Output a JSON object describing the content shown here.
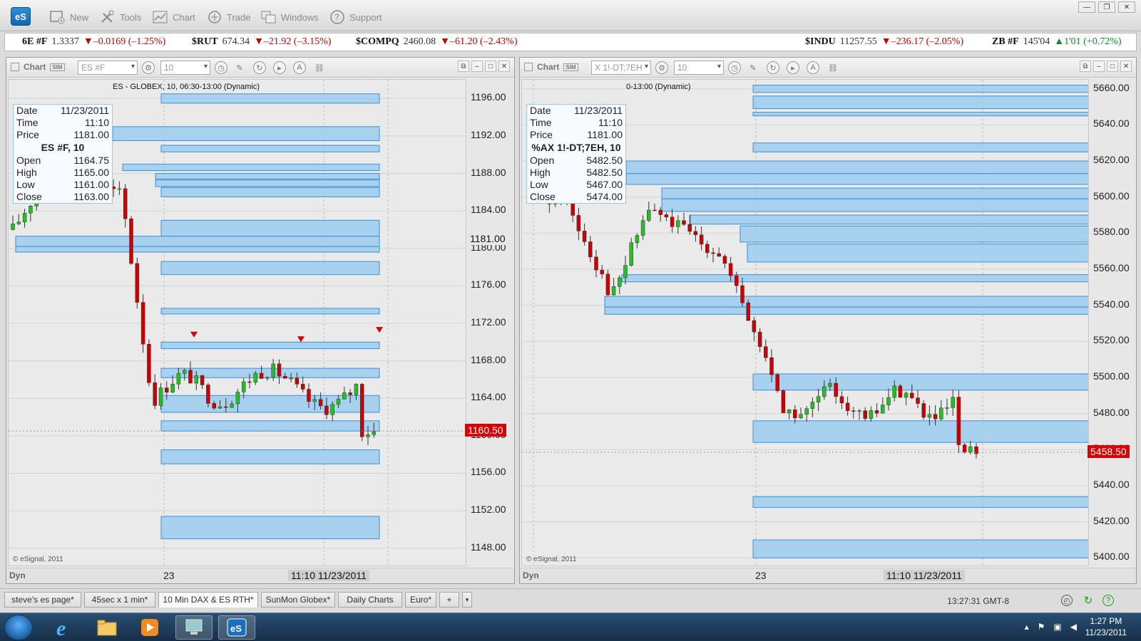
{
  "app": {
    "logo": "eS",
    "toolbar": [
      {
        "label": "New",
        "icon": "new-window-icon"
      },
      {
        "label": "Tools",
        "icon": "tools-icon"
      },
      {
        "label": "Chart",
        "icon": "chart-icon"
      },
      {
        "label": "Trade",
        "icon": "trade-icon"
      },
      {
        "label": "Windows",
        "icon": "windows-icon"
      },
      {
        "label": "Support",
        "icon": "help-icon"
      }
    ]
  },
  "ticker": [
    {
      "symbol": "6E #F",
      "price": "1.3337",
      "change": "▼–0.0169 (–1.25%)",
      "dir": "down"
    },
    {
      "symbol": "$RUT",
      "price": "674.34",
      "change": "▼–21.92 (–3.15%)",
      "dir": "down"
    },
    {
      "symbol": "$COMPQ",
      "price": "2460.08",
      "change": "▼–61.20 (–2.43%)",
      "dir": "down"
    },
    {
      "symbol": "$INDU",
      "price": "11257.55",
      "change": "▼–236.17 (–2.05%)",
      "dir": "down"
    },
    {
      "symbol": "ZB #F",
      "price": "145'04",
      "change": "▲1'01 (+0.72%)",
      "dir": "up"
    }
  ],
  "left_chart": {
    "title": "Chart",
    "symbol": "ES #F",
    "interval": "10",
    "study_label": "ES - GLOBEX, 10, 06:30-13:00 (Dynamic)",
    "info": {
      "rows_top": [
        [
          "Date",
          "11/23/2011"
        ],
        [
          "Time",
          "11:10"
        ],
        [
          "Price",
          "1181.00"
        ]
      ],
      "header": "ES #F, 10",
      "rows_bottom": [
        [
          "Open",
          "1164.75"
        ],
        [
          "High",
          "1165.00"
        ],
        [
          "Low",
          "1161.00"
        ],
        [
          "Close",
          "1163.00"
        ]
      ]
    },
    "y_ticks": [
      "1196.00",
      "1192.00",
      "1188.00",
      "1184.00",
      "1180.00",
      "1176.00",
      "1172.00",
      "1168.00",
      "1164.00",
      "1160.00",
      "1156.00",
      "1152.00",
      "1148.00"
    ],
    "crosshair_price": "1181.00",
    "last_price": "1160.50",
    "x_label": "23",
    "x_time": "11:10 11/23/2011",
    "copyright": "© eSignal, 2011",
    "dyn": "Dyn"
  },
  "right_chart": {
    "title": "Chart",
    "symbol": "X 1!-DT;7EH",
    "interval": "10",
    "study_label": "0-13:00 (Dynamic)",
    "info": {
      "rows_top": [
        [
          "Date",
          "11/23/2011"
        ],
        [
          "Time",
          "11:10"
        ],
        [
          "Price",
          "1181.00"
        ]
      ],
      "header": "%AX 1!-DT;7EH, 10",
      "rows_bottom": [
        [
          "Open",
          "5482.50"
        ],
        [
          "High",
          "5482.50"
        ],
        [
          "Low",
          "5467.00"
        ],
        [
          "Close",
          "5474.00"
        ]
      ]
    },
    "y_ticks": [
      "5660.00",
      "5640.00",
      "5620.00",
      "5600.00",
      "5580.00",
      "5560.00",
      "5540.00",
      "5520.00",
      "5500.00",
      "5480.00",
      "5460.00",
      "5440.00",
      "5420.00",
      "5400.00"
    ],
    "last_price": "5458.50",
    "x_label": "23",
    "x_time": "11:10 11/23/2011",
    "copyright": "© eSignal, 2011",
    "dyn": "Dyn"
  },
  "tabs": [
    {
      "label": "steve's es page*",
      "active": false
    },
    {
      "label": "45sec x 1 min*",
      "active": false
    },
    {
      "label": "10 Min DAX & ES RTH*",
      "active": true
    },
    {
      "label": "SunMon Globex*",
      "active": false
    },
    {
      "label": "Daily Charts",
      "active": false
    },
    {
      "label": "Euro*",
      "active": false
    },
    {
      "label": "+",
      "active": false
    }
  ],
  "status": {
    "clock": "13:27:31 GMT-8"
  },
  "taskbar": {
    "time": "1:27 PM",
    "date": "11/23/2011"
  },
  "colors": {
    "zone_fill": "#9ccbf0",
    "zone_stroke": "#3f8fd4",
    "up_candle": "#22c022",
    "down_candle": "#cc0000",
    "price_tag": "#d90000"
  },
  "chart_data": [
    {
      "type": "candlestick",
      "title": "ES - GLOBEX, 10, 06:30-13:00 (Dynamic)",
      "ylim": [
        1146,
        1198
      ],
      "supply_demand_zones": [
        [
          1195.5,
          1196.5
        ],
        [
          1191.5,
          1193.0
        ],
        [
          1190.3,
          1191.0
        ],
        [
          1188.3,
          1189.0
        ],
        [
          1187.4,
          1188.0
        ],
        [
          1186.6,
          1187.3
        ],
        [
          1185.5,
          1186.5
        ],
        [
          1181.3,
          1183.0
        ],
        [
          1180.2,
          1181.3
        ],
        [
          1179.6,
          1180.2
        ],
        [
          1177.2,
          1178.6
        ],
        [
          1173.0,
          1173.6
        ],
        [
          1169.3,
          1170.0
        ],
        [
          1166.2,
          1167.2
        ],
        [
          1162.5,
          1164.3
        ],
        [
          1160.5,
          1161.6
        ],
        [
          1157.0,
          1158.5
        ],
        [
          1149.0,
          1151.4
        ]
      ],
      "last_close": 1160.5,
      "x_label": "23"
    },
    {
      "type": "candlestick",
      "title": "0-13:00 (Dynamic)",
      "ylim": [
        5395,
        5665
      ],
      "supply_demand_zones": [
        [
          5658,
          5662
        ],
        [
          5649,
          5656
        ],
        [
          5645,
          5647
        ],
        [
          5625,
          5630
        ],
        [
          5613,
          5620
        ],
        [
          5607,
          5613
        ],
        [
          5599,
          5605
        ],
        [
          5592,
          5599
        ],
        [
          5585,
          5590
        ],
        [
          5575,
          5584
        ],
        [
          5564,
          5574
        ],
        [
          5553,
          5557
        ],
        [
          5539,
          5545
        ],
        [
          5535,
          5539
        ],
        [
          5493,
          5502
        ],
        [
          5464,
          5476
        ],
        [
          5428,
          5434
        ],
        [
          5400,
          5410
        ]
      ],
      "last_close": 5458.5,
      "x_label": "23"
    }
  ]
}
